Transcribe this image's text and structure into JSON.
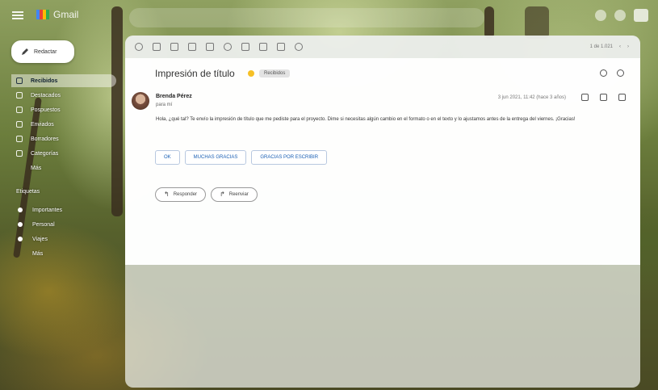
{
  "app": {
    "name": "Gmail"
  },
  "compose": {
    "label": "Redactar"
  },
  "nav": {
    "items": [
      {
        "label": "Recibidos",
        "count": "",
        "active": true
      },
      {
        "label": "Destacados",
        "count": "",
        "active": false
      },
      {
        "label": "Pospuestos",
        "count": "",
        "active": false
      },
      {
        "label": "Enviados",
        "count": "",
        "active": false
      },
      {
        "label": "Borradores",
        "count": "",
        "active": false
      },
      {
        "label": "Categorías",
        "count": "",
        "active": false
      },
      {
        "label": "Más",
        "count": "",
        "active": false
      }
    ]
  },
  "labels": {
    "heading": "Etiquetas",
    "items": [
      {
        "label": "Importantes"
      },
      {
        "label": "Personal"
      },
      {
        "label": "Viajes"
      },
      {
        "label": "Más"
      }
    ]
  },
  "toolbar": {
    "pager": "1 de 1.021"
  },
  "email": {
    "subject": "Impresión de título",
    "badge": "Recibidos",
    "sender": "Brenda Pérez",
    "to": "para mí",
    "date": "3 jun 2021, 11:42 (hace 3 años)",
    "body": "Hola, ¿qué tal? Te envío la impresión de título que me pediste para el proyecto. Dime si necesitas algún cambio en el formato o en el texto y lo ajustamos antes de la entrega del viernes. ¡Gracias!",
    "chips": [
      "OK",
      "MUCHAS GRACIAS",
      "GRACIAS POR ESCRIBIR"
    ],
    "reply_label": "Responder",
    "forward_label": "Reenviar"
  },
  "colors": {
    "accent": "#1a5fb4",
    "star": "#f6c026"
  }
}
